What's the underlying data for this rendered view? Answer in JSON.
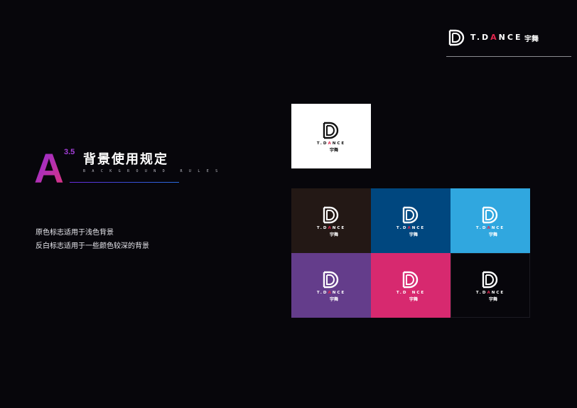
{
  "header": {
    "brand": "T.DANCE",
    "brand_cn": "宇舞"
  },
  "section": {
    "letter": "A",
    "number": "3.5",
    "title": "背景使用规定",
    "subtitle": "BACKGROUND RULES"
  },
  "descriptions": [
    "原色标志适用于浅色背景",
    "反白标志适用于一些颜色较深的背景"
  ],
  "colors": {
    "accent_red": "#e3264e",
    "gradient_purple": "#8a2be2",
    "gradient_magenta": "#e0357a"
  },
  "swatches": [
    {
      "background": "#ffffff",
      "logo_color": "#111111",
      "brand": "T.DANCE",
      "brand_cn": "宇舞"
    },
    {
      "background": "#231815",
      "logo_color": "#ffffff",
      "brand": "T.DANCE",
      "brand_cn": "宇舞"
    },
    {
      "background": "#00477f",
      "logo_color": "#ffffff",
      "brand": "T.DANCE",
      "brand_cn": "宇舞"
    },
    {
      "background": "#30a7df",
      "logo_color": "#ffffff",
      "brand": "T.DANCE",
      "brand_cn": "宇舞"
    },
    {
      "background": "#643d8b",
      "logo_color": "#ffffff",
      "brand": "T.DANCE",
      "brand_cn": "宇舞"
    },
    {
      "background": "#d7296f",
      "logo_color": "#ffffff",
      "brand": "T.DANCE",
      "brand_cn": "宇舞"
    },
    {
      "background": "#07060b",
      "logo_color": "#ffffff",
      "brand": "T.DANCE",
      "brand_cn": "宇舞"
    }
  ]
}
